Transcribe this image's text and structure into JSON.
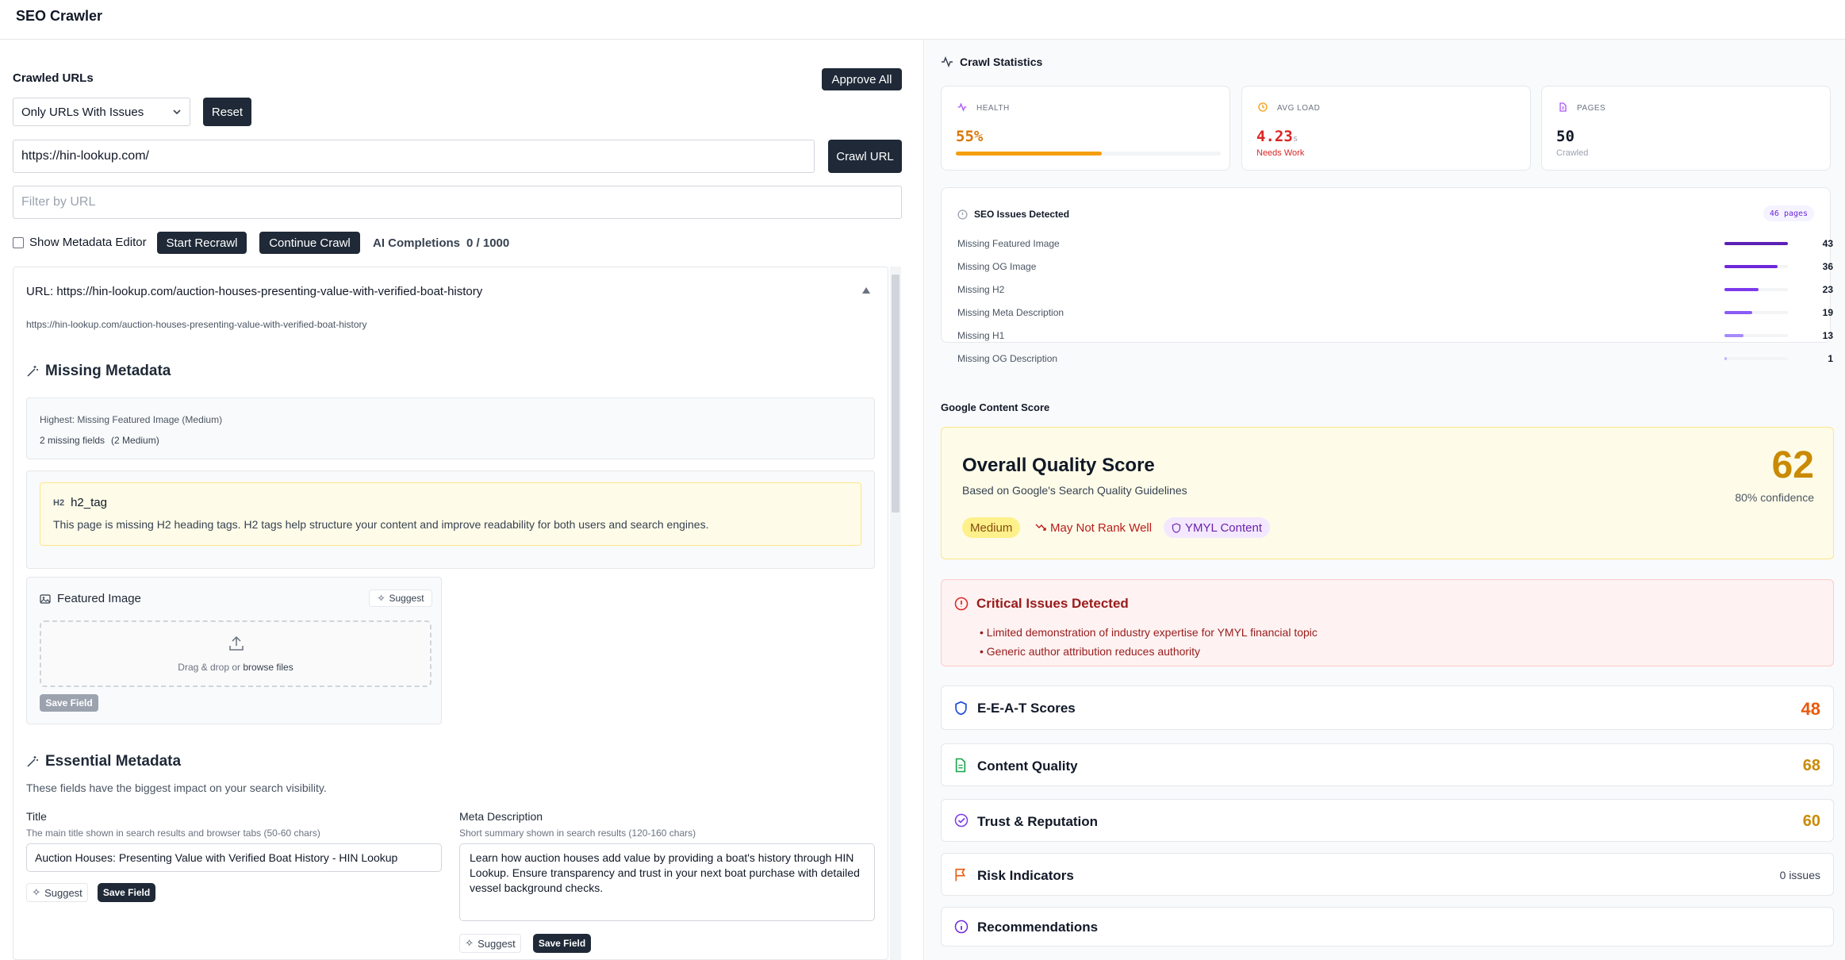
{
  "app": {
    "title": "SEO Crawler"
  },
  "left": {
    "section_title": "Crawled URLs",
    "approve_all": "Approve All",
    "filter_select": "Only URLs With Issues",
    "reset": "Reset",
    "url_input": "https://hin-lookup.com/",
    "crawl_url": "Crawl URL",
    "filter_placeholder": "Filter by URL",
    "show_metadata_editor": "Show Metadata Editor",
    "start_recrawl": "Start Recrawl",
    "continue_crawl": "Continue Crawl",
    "ai_completions_label": "AI Completions",
    "ai_completions_value": "0 / 1000",
    "url_card": {
      "header": "URL: https://hin-lookup.com/auction-houses-presenting-value-with-verified-boat-history",
      "sub_url": "https://hin-lookup.com/auction-houses-presenting-value-with-verified-boat-history"
    },
    "missing_metadata": {
      "title": "Missing Metadata",
      "highest": "Highest: Missing Featured Image (Medium)",
      "missing_fields": "2 missing fields",
      "medium_count": "(2 Medium)",
      "h2_badge": "H2",
      "h2_tag": "h2_tag",
      "h2_message": "This page is missing H2 heading tags. H2 tags help structure your content and improve readability for both users and search engines.",
      "featured_image": "Featured Image",
      "suggest": "Suggest",
      "drag_drop": "Drag & drop or",
      "browse_files": "browse files",
      "save_field": "Save Field"
    },
    "essential": {
      "title": "Essential Metadata",
      "subtitle": "These fields have the biggest impact on your search visibility.",
      "title_label": "Title",
      "title_hint": "The main title shown in search results and browser tabs (50-60 chars)",
      "title_value": "Auction Houses: Presenting Value with Verified Boat History - HIN Lookup",
      "meta_label": "Meta Description",
      "meta_hint": "Short summary shown in search results (120-160 chars)",
      "meta_value": "Learn how auction houses add value by providing a boat's history through HIN Lookup. Ensure transparency and trust in your next boat purchase with detailed vessel background checks.",
      "suggest": "Suggest",
      "save_field": "Save Field"
    }
  },
  "right": {
    "crawl_statistics": "Crawl Statistics",
    "health": {
      "label": "HEALTH",
      "value": "55%",
      "progress": 0.55
    },
    "avg_load": {
      "label": "AVG LOAD",
      "value": "4.23",
      "unit": "s",
      "status": "Needs Work"
    },
    "pages": {
      "label": "PAGES",
      "value": "50",
      "sub": "Crawled"
    },
    "seo_issues": {
      "title": "SEO Issues Detected",
      "badge": "46 pages",
      "max": 43,
      "items": [
        {
          "name": "Missing Featured Image",
          "count": 43,
          "color": "#5b21b6"
        },
        {
          "name": "Missing OG Image",
          "count": 36,
          "color": "#6d28d9"
        },
        {
          "name": "Missing H2",
          "count": 23,
          "color": "#7c3aed"
        },
        {
          "name": "Missing Meta Description",
          "count": 19,
          "color": "#8b5cf6"
        },
        {
          "name": "Missing H1",
          "count": 13,
          "color": "#a78bfa"
        },
        {
          "name": "Missing OG Description",
          "count": 1,
          "color": "#c4b5fd"
        }
      ]
    },
    "google_content_score": "Google Content Score",
    "quality": {
      "title": "Overall Quality Score",
      "subtitle": "Based on Google's Search Quality Guidelines",
      "score": "62",
      "confidence": "80% confidence",
      "tag_medium": "Medium",
      "tag_rank": "May Not Rank Well",
      "tag_ymyl": "YMYL Content"
    },
    "critical": {
      "title": "Critical Issues Detected",
      "items": [
        "Limited demonstration of industry expertise for YMYL financial topic",
        "Generic author attribution reduces authority"
      ]
    },
    "sections": {
      "eeat": {
        "title": "E-E-A-T Scores",
        "score": "48"
      },
      "content": {
        "title": "Content Quality",
        "score": "68"
      },
      "trust": {
        "title": "Trust & Reputation",
        "score": "60"
      },
      "risk": {
        "title": "Risk Indicators",
        "score": "0 issues"
      },
      "recs": {
        "title": "Recommendations"
      }
    }
  }
}
